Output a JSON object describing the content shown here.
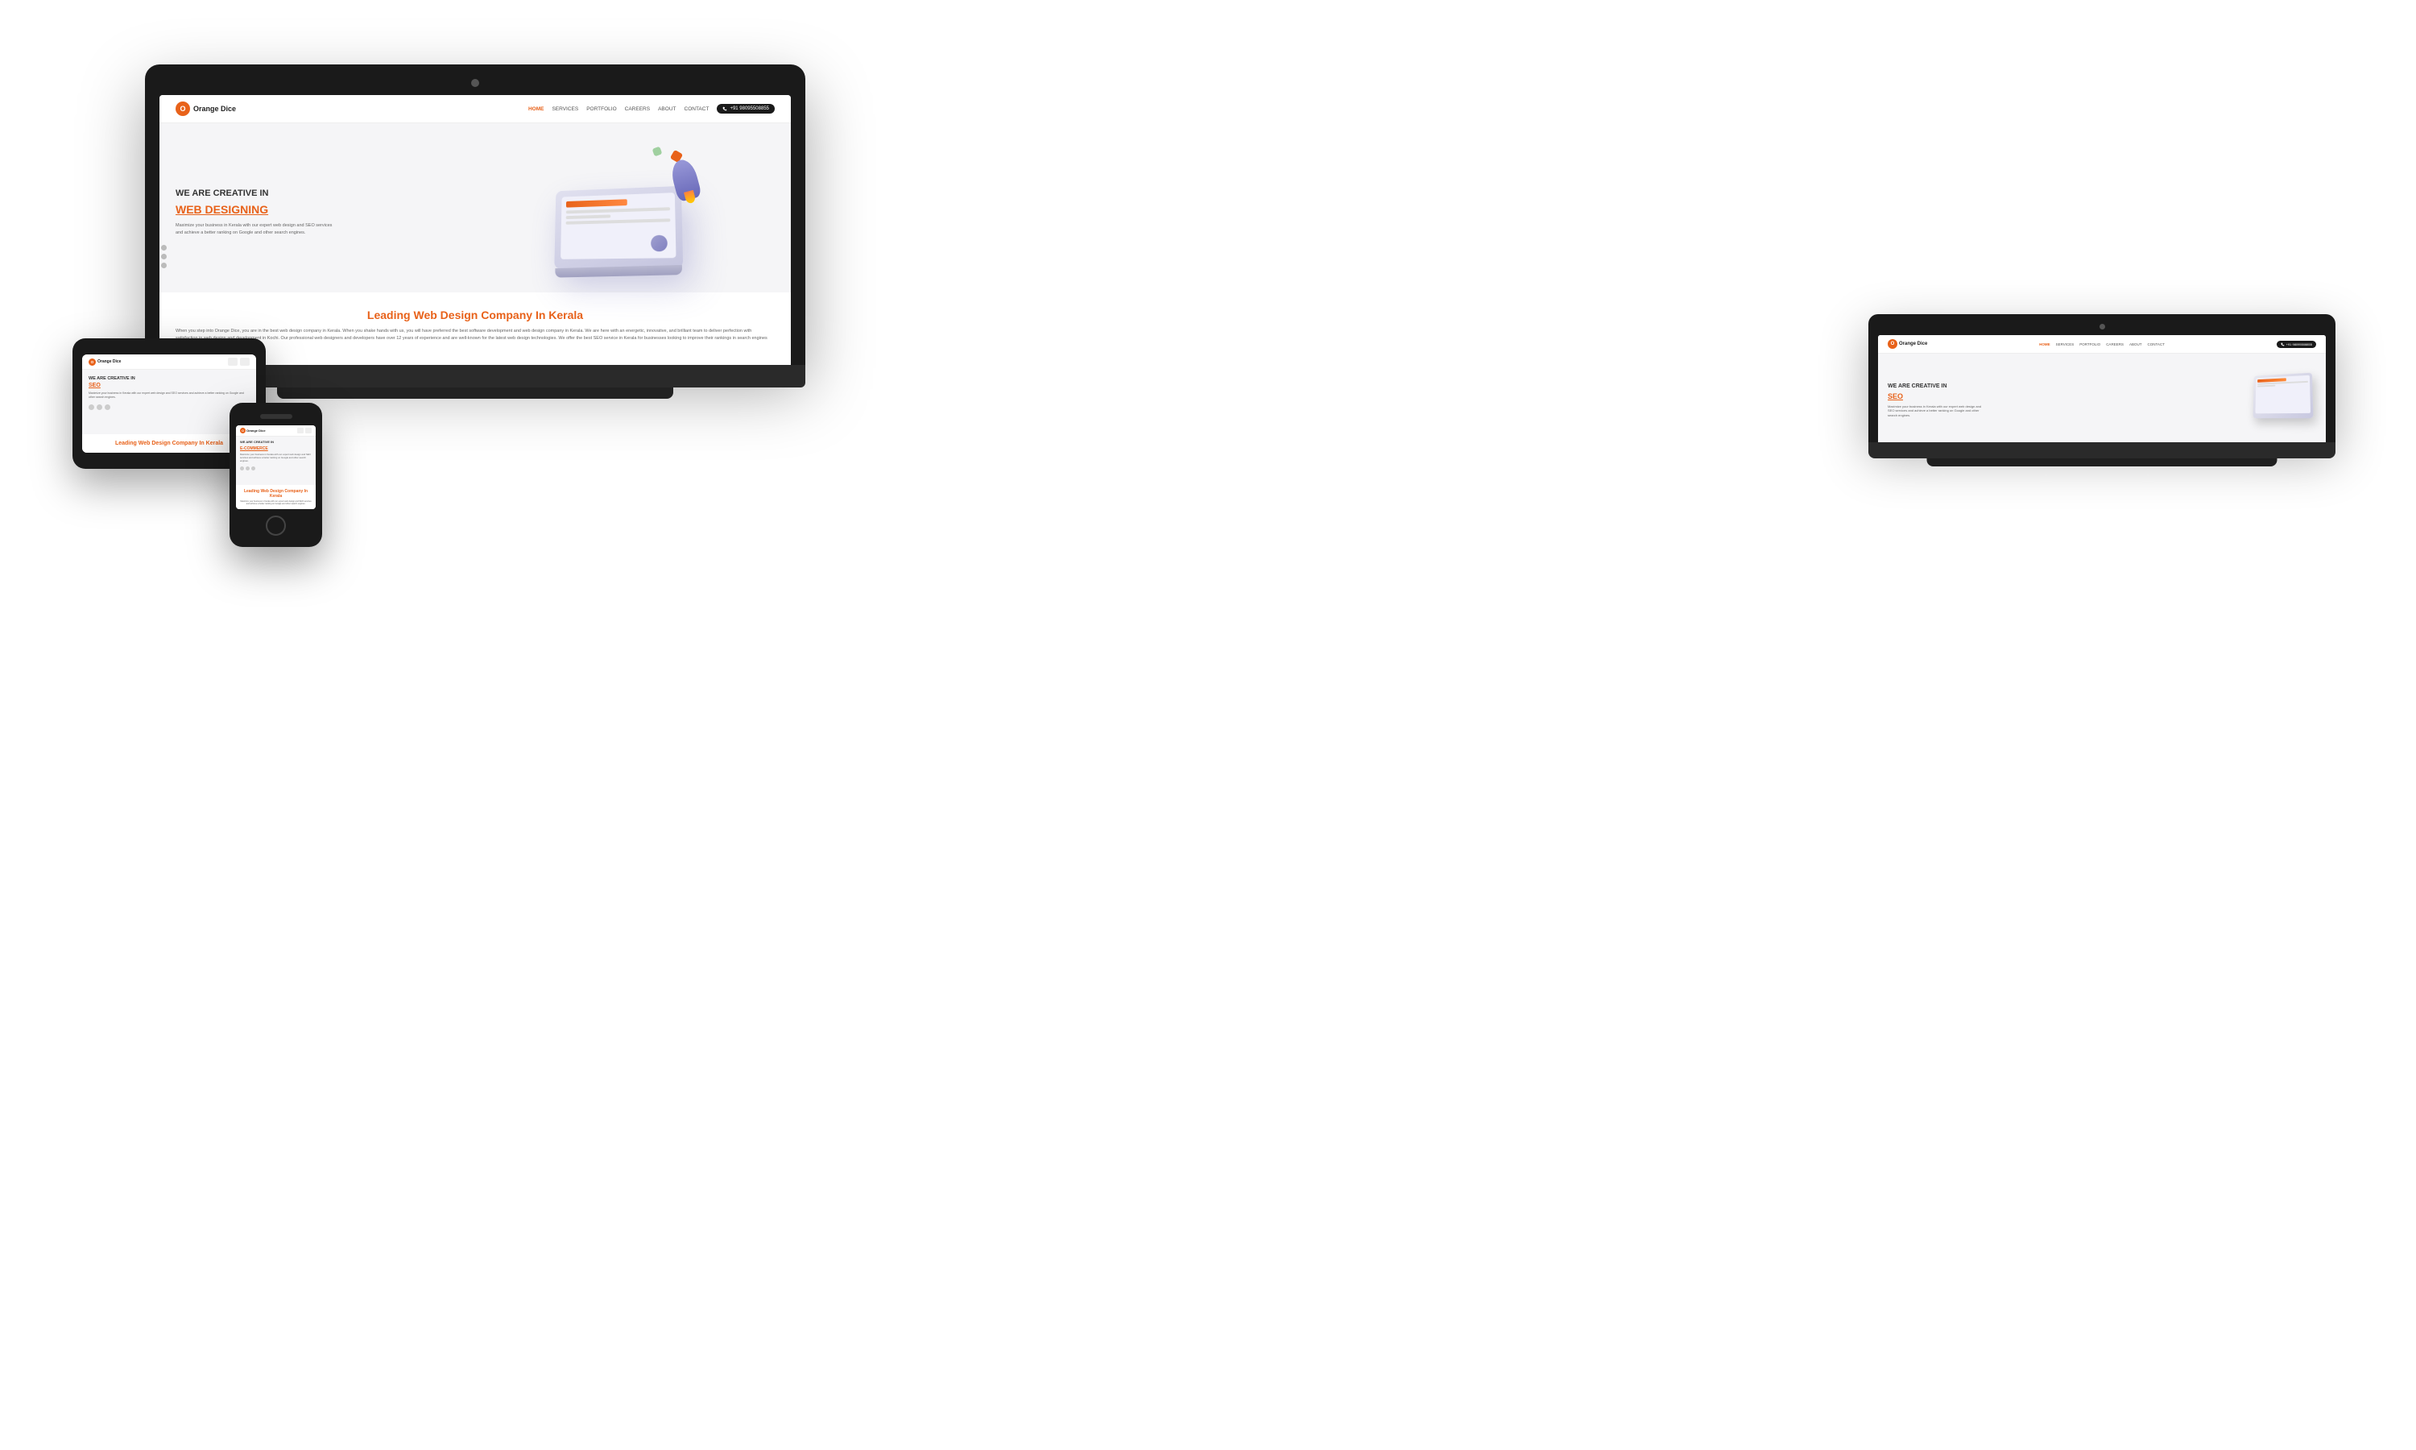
{
  "scene": {
    "bg": "#ffffff"
  },
  "brand": {
    "name": "Orange Dice",
    "logo_letter": "O"
  },
  "desktop": {
    "nav": {
      "home": "HOME",
      "services": "SERVICES",
      "portfolio": "PORTFOLIO",
      "careers": "CAREERS",
      "about": "ABOUT",
      "contact": "CONTACT",
      "phone": "+91 98095508855"
    },
    "hero": {
      "subtitle": "WE ARE CREATIVE IN",
      "title": "WEB DESIGNING",
      "desc": "Maximize your business in Kerala with our expert web design and SEO services and achieve a better ranking on Google and other search engines."
    },
    "section": {
      "leading": "Leading",
      "webdesign": "Web Design",
      "company": "Company",
      "in": "In Kerala",
      "body": "When you step into Orange Dice, you are in the best web design company in Kerala. When you shake hands with us, you will have preferred the best software development and web design company in Kerala. We are here with an energetic, innovative, and brilliant team to deliver perfection with satisfaction in web design and development in Kochi. Our professional web designers and developers have over 12 years of experience and are well-known for the latest web design technologies. We offer the best SEO service in Kerala for businesses looking to improve their rankings in search engines like Google and Bing."
    }
  },
  "laptop": {
    "nav": {
      "home": "HOME",
      "services": "SERVICES",
      "portfolio": "PORTFOLIO",
      "careers": "CAREERS",
      "about": "ABOUT",
      "contact": "CONTACT",
      "phone": "+91 98095508855"
    },
    "hero": {
      "subtitle": "WE ARE CREATIVE IN",
      "title": "SEO",
      "desc": "Maximize your business in Kerala with our expert web design and SEO services and achieve a better ranking on Google and other search engines."
    }
  },
  "tablet": {
    "hero": {
      "subtitle": "WE ARE CREATIVE IN",
      "title": "SEO",
      "desc": "Maximize your business in Kerala with our expert web design and SEO services and achieve a better ranking on Google and other search engines."
    },
    "section": {
      "leading": "Leading",
      "webdesign": "Web Design",
      "company": "Company",
      "in": "In Kerala"
    }
  },
  "phone": {
    "hero": {
      "subtitle": "WE ARE CREATIVE IN",
      "title": "E-COMMERCE",
      "desc": "Maximize your business in Kerala with our expert web design and SEO services and achieve a better ranking on Google and other search engines."
    },
    "section": {
      "leading": "Leading",
      "webdesign": "Web Design",
      "company": "Company",
      "in": "In Kerala"
    }
  }
}
